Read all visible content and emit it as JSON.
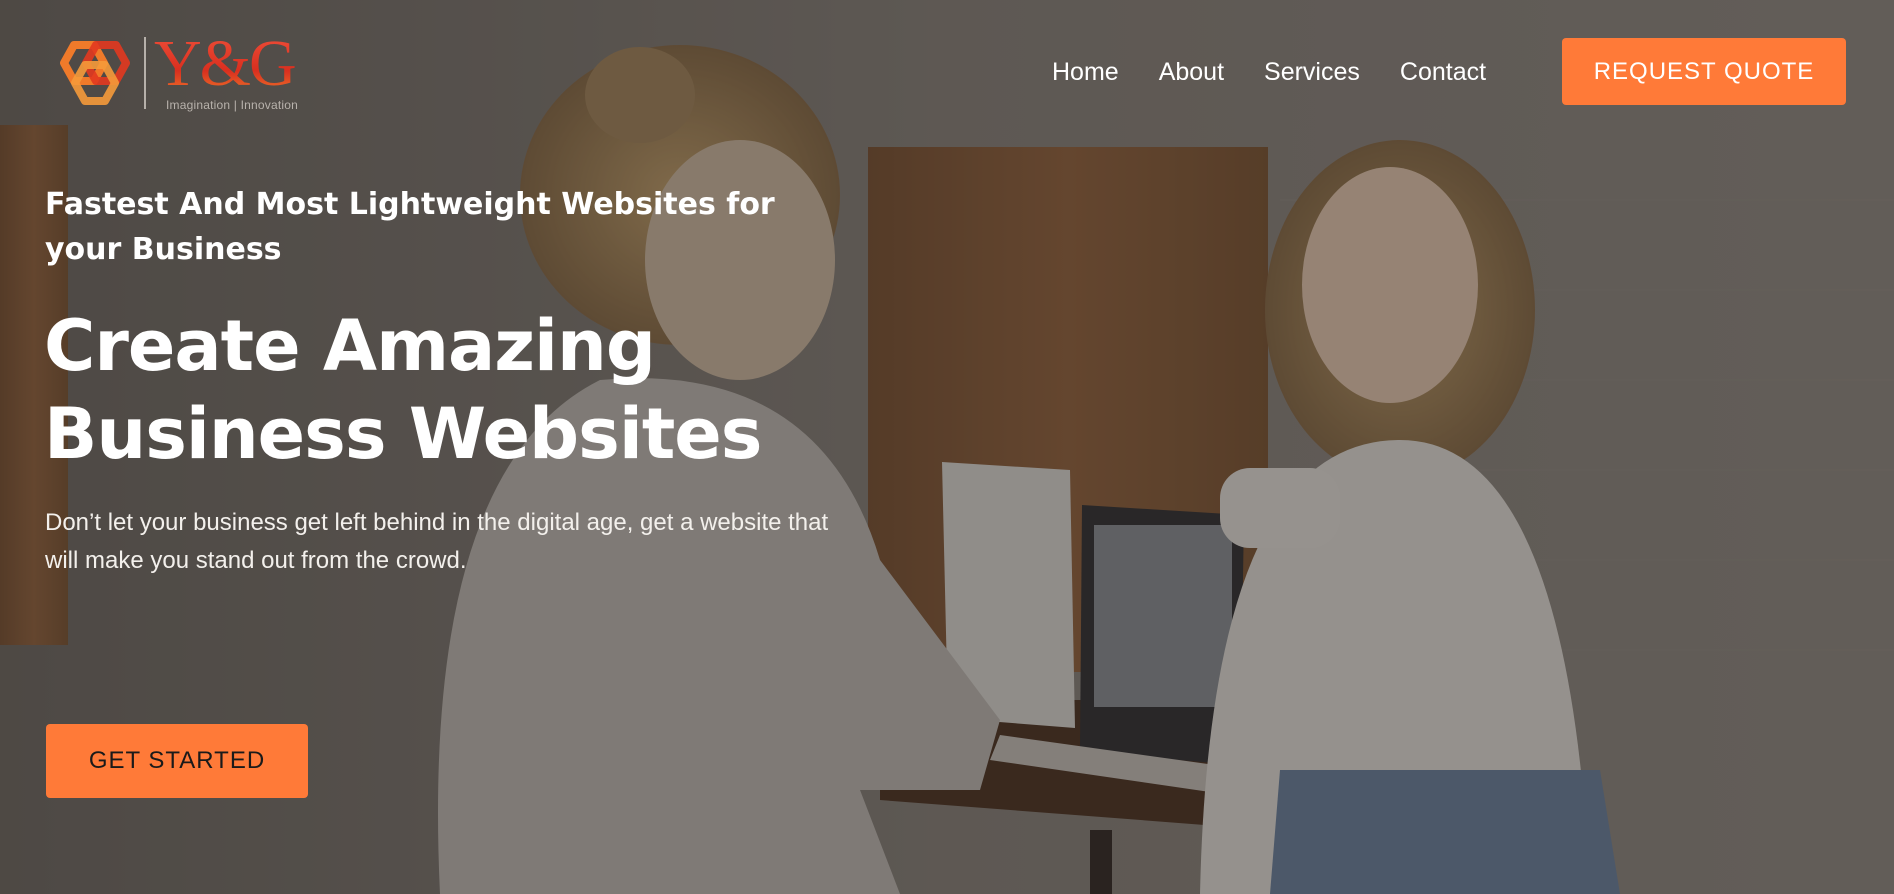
{
  "brand": {
    "logo_letters": "Y&G",
    "tagline": "Imagination | Innovation",
    "accent_color": "#ff7a38",
    "logo_color": "#e2381f"
  },
  "nav": {
    "items": [
      {
        "label": "Home"
      },
      {
        "label": "About"
      },
      {
        "label": "Services"
      },
      {
        "label": "Contact"
      }
    ],
    "cta_label": "REQUEST QUOTE"
  },
  "hero": {
    "eyebrow": "Fastest And Most Lightweight Websites for your Business",
    "headline_line1": "Create Amazing",
    "headline_line2": "Business Websites",
    "lead": "Don’t let your business get left behind in the digital age, get a website that will make you stand out from the crowd.",
    "cta_label": "GET STARTED",
    "background": "photo-two-women-laptop-cafe"
  }
}
